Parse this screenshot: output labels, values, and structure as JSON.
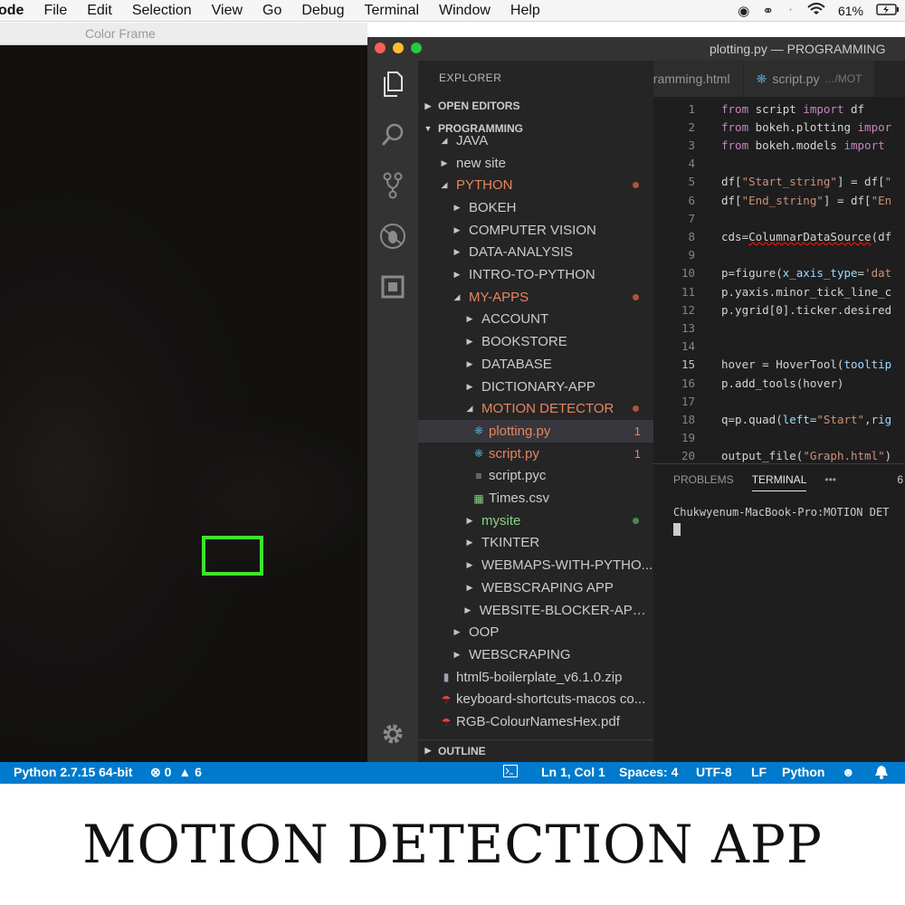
{
  "menubar": {
    "app": "ode",
    "items": [
      "File",
      "Edit",
      "Selection",
      "View",
      "Go",
      "Debug",
      "Terminal",
      "Window",
      "Help"
    ],
    "battery": "61%"
  },
  "camera_window": {
    "title": "Color Frame",
    "detection_box_color": "#3fe22c"
  },
  "vscode": {
    "window_title": "plotting.py — PROGRAMMING",
    "traffic_lights": [
      "#ff5f57",
      "#febc2e",
      "#28c840"
    ],
    "activity_icons": [
      "files-icon",
      "search-icon",
      "source-control-icon",
      "debug-icon",
      "extensions-icon",
      "settings-icon"
    ],
    "explorer": {
      "header": "EXPLORER",
      "open_editors": "OPEN EDITORS",
      "workspace": "PROGRAMMING",
      "outline": "OUTLINE",
      "tree": [
        {
          "label": "JAVA",
          "depth": 1,
          "twisty": "open",
          "color": "normal"
        },
        {
          "label": "new site",
          "depth": 1,
          "twisty": "closed",
          "color": "normal"
        },
        {
          "label": "PYTHON",
          "depth": 1,
          "twisty": "open",
          "color": "orange",
          "mark": "dot"
        },
        {
          "label": "BOKEH",
          "depth": 2,
          "twisty": "closed",
          "color": "normal"
        },
        {
          "label": "COMPUTER VISION",
          "depth": 2,
          "twisty": "closed",
          "color": "normal"
        },
        {
          "label": "DATA-ANALYSIS",
          "depth": 2,
          "twisty": "closed",
          "color": "normal"
        },
        {
          "label": "INTRO-TO-PYTHON",
          "depth": 2,
          "twisty": "closed",
          "color": "normal"
        },
        {
          "label": "MY-APPS",
          "depth": 2,
          "twisty": "open",
          "color": "orange",
          "mark": "dot"
        },
        {
          "label": "ACCOUNT",
          "depth": 3,
          "twisty": "closed",
          "color": "normal"
        },
        {
          "label": "BOOKSTORE",
          "depth": 3,
          "twisty": "closed",
          "color": "normal"
        },
        {
          "label": "DATABASE",
          "depth": 3,
          "twisty": "closed",
          "color": "normal"
        },
        {
          "label": "DICTIONARY-APP",
          "depth": 3,
          "twisty": "closed",
          "color": "normal"
        },
        {
          "label": "MOTION DETECTOR",
          "depth": 3,
          "twisty": "open",
          "color": "orange",
          "mark": "dot"
        },
        {
          "label": "plotting.py",
          "depth": 4,
          "file": "py",
          "color": "orange",
          "badge": "1",
          "selected": true
        },
        {
          "label": "script.py",
          "depth": 4,
          "file": "py",
          "color": "orange",
          "badge": "1"
        },
        {
          "label": "script.pyc",
          "depth": 4,
          "file": "txt",
          "color": "normal"
        },
        {
          "label": "Times.csv",
          "depth": 4,
          "file": "csv",
          "color": "normal"
        },
        {
          "label": "mysite",
          "depth": 3,
          "twisty": "closed",
          "color": "green",
          "mark": "gdot"
        },
        {
          "label": "TKINTER",
          "depth": 3,
          "twisty": "closed",
          "color": "normal"
        },
        {
          "label": "WEBMAPS-WITH-PYTHO...",
          "depth": 3,
          "twisty": "closed",
          "color": "normal"
        },
        {
          "label": "WEBSCRAPING APP",
          "depth": 3,
          "twisty": "closed",
          "color": "normal"
        },
        {
          "label": "WEBSITE-BLOCKER-APPL...",
          "depth": 3,
          "twisty": "closed",
          "color": "normal"
        },
        {
          "label": "OOP",
          "depth": 2,
          "twisty": "closed",
          "color": "normal"
        },
        {
          "label": "WEBSCRAPING",
          "depth": 2,
          "twisty": "closed",
          "color": "normal"
        },
        {
          "label": "html5-boilerplate_v6.1.0.zip",
          "depth": 1,
          "file": "zip",
          "color": "normal"
        },
        {
          "label": "keyboard-shortcuts-macos co...",
          "depth": 1,
          "file": "pdf",
          "color": "normal"
        },
        {
          "label": "RGB-ColourNamesHex.pdf",
          "depth": 1,
          "file": "pdf",
          "color": "normal"
        }
      ]
    },
    "tabs": [
      {
        "label": "gramming.html",
        "path": ""
      },
      {
        "label": "script.py",
        "path": "…/MOT"
      }
    ],
    "code": [
      {
        "n": "1",
        "html": "<span class='kw'>from</span> script <span class='kw'>import</span> df"
      },
      {
        "n": "2",
        "html": "<span class='kw'>from</span> bokeh.plotting <span class='kw'>impor</span>"
      },
      {
        "n": "3",
        "html": "<span class='kw'>from</span> bokeh.models <span class='kw'>import</span>"
      },
      {
        "n": "4",
        "html": ""
      },
      {
        "n": "5",
        "html": "df[<span class='str'>\"Start_string\"</span>] = df[<span class='str'>\"</span>"
      },
      {
        "n": "6",
        "html": "df[<span class='str'>\"End_string\"</span>] = df[<span class='str'>\"En</span>"
      },
      {
        "n": "7",
        "html": ""
      },
      {
        "n": "8",
        "html": "cds=<span class='sq'>ColumnarDataSource</span>(df"
      },
      {
        "n": "9",
        "html": ""
      },
      {
        "n": "10",
        "html": "p=figure(<span class='var'>x_axis_type</span>=<span class='str'>'dat</span>"
      },
      {
        "n": "11",
        "html": "p.yaxis.minor_tick_line_c"
      },
      {
        "n": "12",
        "html": "p.ygrid[0].ticker.desired"
      },
      {
        "n": "13",
        "html": ""
      },
      {
        "n": "14",
        "html": ""
      },
      {
        "n": "15",
        "html": "hover = HoverTool(<span class='var'>tooltip</span>",
        "current": true
      },
      {
        "n": "16",
        "html": "p.add_tools(hover)"
      },
      {
        "n": "17",
        "html": ""
      },
      {
        "n": "18",
        "html": "q=p.quad(<span class='var'>left</span>=<span class='str'>\"Start\"</span>,<span class='var'>rig</span>"
      },
      {
        "n": "19",
        "html": ""
      },
      {
        "n": "20",
        "html": "output_file(<span class='str'>\"Graph.html\"</span>)"
      }
    ],
    "panel": {
      "tabs": [
        "PROBLEMS",
        "TERMINAL",
        "•••"
      ],
      "active": "TERMINAL",
      "count": "6",
      "terminal_line": "Chukwyenum-MacBook-Pro:MOTION DET"
    },
    "status": {
      "python": "Python 2.7.15 64-bit",
      "errors": "0",
      "warnings": "6",
      "position": "Ln 1, Col 1",
      "spaces": "Spaces: 4",
      "encoding": "UTF-8",
      "eol": "LF",
      "language": "Python"
    }
  },
  "caption": "MOTION DETECTION APP"
}
